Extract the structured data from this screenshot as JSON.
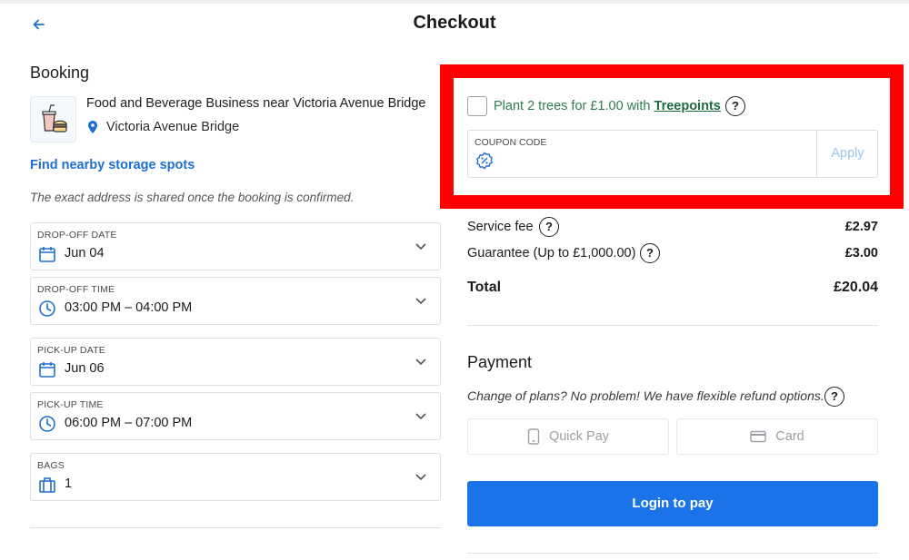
{
  "header": {
    "title": "Checkout",
    "back_icon": "arrow-left-icon"
  },
  "booking": {
    "title": "Booking",
    "store_name": "Food and Beverage Business near Victoria Avenue Bridge",
    "store_location": "Victoria Avenue Bridge",
    "find_link": "Find nearby storage spots",
    "address_note": "The exact address is shared once the booking is confirmed.",
    "fields": [
      {
        "label": "DROP-OFF DATE",
        "value": "Jun 04",
        "icon": "calendar-icon"
      },
      {
        "label": "DROP-OFF TIME",
        "value": "03:00 PM – 04:00 PM",
        "icon": "clock-icon"
      },
      {
        "label": "PICK-UP DATE",
        "value": "Jun 06",
        "icon": "calendar-icon"
      },
      {
        "label": "PICK-UP TIME",
        "value": "06:00 PM – 07:00 PM",
        "icon": "clock-icon"
      },
      {
        "label": "BAGS",
        "value": "1",
        "icon": "luggage-icon"
      }
    ]
  },
  "offer": {
    "tree_text": "Plant 2 trees for £1.00 with ",
    "tree_link": "Treepoints",
    "help": "?"
  },
  "coupon": {
    "label": "COUPON CODE",
    "apply": "Apply"
  },
  "summary": {
    "service_fee_label": "Service fee",
    "service_fee": "£2.97",
    "guarantee_label": "Guarantee (Up to £1,000.00)",
    "guarantee": "£3.00",
    "total_label": "Total",
    "total": "£20.04"
  },
  "payment": {
    "title": "Payment",
    "note": "Change of plans? No problem! We have flexible refund options.",
    "quick_pay": "Quick Pay",
    "card": "Card",
    "login_button": "Login to pay"
  },
  "colors": {
    "accent": "#1a73e8",
    "link": "#1f6fd1",
    "highlight": "#ff0000",
    "green": "#2e7d4f"
  }
}
